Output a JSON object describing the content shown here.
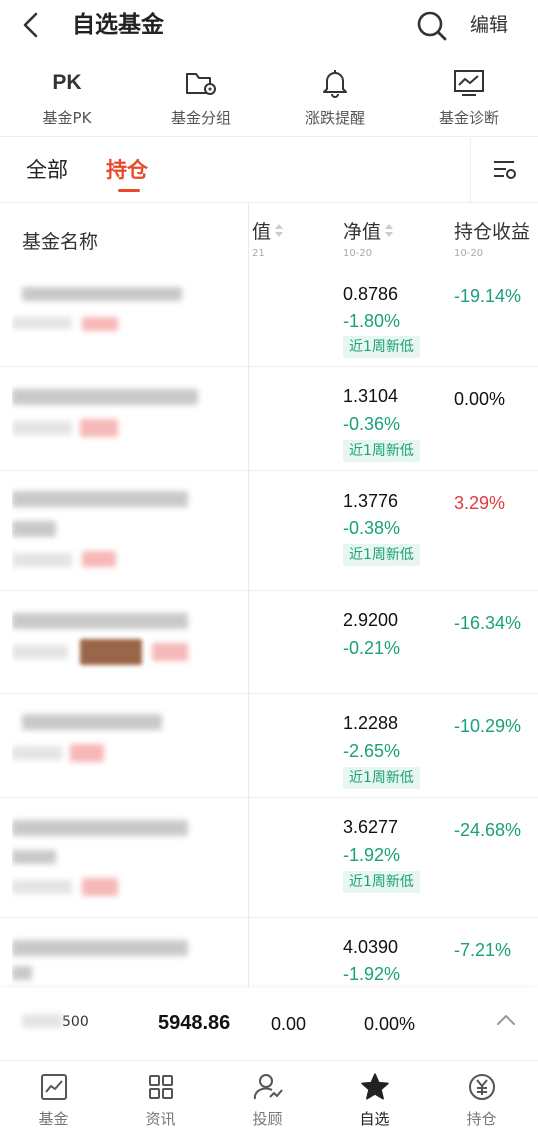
{
  "header": {
    "title": "自选基金",
    "edit_label": "编辑"
  },
  "tools": [
    {
      "label": "基金PK",
      "icon_text": "PK",
      "icon": "pk-icon"
    },
    {
      "label": "基金分组",
      "icon": "folder-settings-icon"
    },
    {
      "label": "涨跌提醒",
      "icon": "bell-icon"
    },
    {
      "label": "基金诊断",
      "icon": "chart-diagnosis-icon"
    }
  ],
  "tabs": {
    "all": "全部",
    "holdings": "持仓",
    "active": "holdings"
  },
  "columns": {
    "name": "基金名称",
    "cut_value": "值",
    "cut_date": "21",
    "nav": "净值",
    "nav_date": "10-20",
    "profit": "持仓收益",
    "profit_date": "10-20"
  },
  "rows": [
    {
      "nav": "0.8786",
      "change": "-1.80%",
      "tag": "近1周新低",
      "profit": "-19.14%",
      "profit_color": "green"
    },
    {
      "nav": "1.3104",
      "change": "-0.36%",
      "tag": "近1周新低",
      "profit": "0.00%",
      "profit_color": "dark"
    },
    {
      "nav": "1.3776",
      "change": "-0.38%",
      "tag": "近1周新低",
      "profit": "3.29%",
      "profit_color": "red"
    },
    {
      "nav": "2.9200",
      "change": "-0.21%",
      "tag": "",
      "profit": "-16.34%",
      "profit_color": "green"
    },
    {
      "nav": "1.2288",
      "change": "-2.65%",
      "tag": "近1周新低",
      "profit": "-10.29%",
      "profit_color": "green"
    },
    {
      "nav": "3.6277",
      "change": "-1.92%",
      "tag": "近1周新低",
      "profit": "-24.68%",
      "profit_color": "green"
    },
    {
      "nav": "4.0390",
      "change": "-1.92%",
      "tag": "",
      "profit": "-7.21%",
      "profit_color": "green"
    }
  ],
  "summary": {
    "label_suffix": "500",
    "amount": "5948.86",
    "profit": "0.00",
    "rate": "0.00%"
  },
  "bottom_nav": [
    {
      "label": "基金",
      "icon": "chart-line-icon"
    },
    {
      "label": "资讯",
      "icon": "grid-icon"
    },
    {
      "label": "投顾",
      "icon": "advisor-icon"
    },
    {
      "label": "自选",
      "icon": "star-icon",
      "active": true
    },
    {
      "label": "持仓",
      "icon": "yen-icon"
    }
  ],
  "colors": {
    "accent": "#e84a2a",
    "up": "#e0383e",
    "down": "#1aa07a"
  }
}
